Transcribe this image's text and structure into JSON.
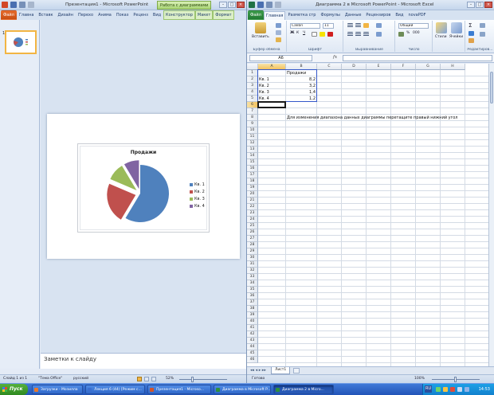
{
  "ppt": {
    "title": "Презентация1 - Microsoft PowerPoint",
    "context_tab_group": "Работа с диаграммами",
    "tabs": [
      "Файл",
      "Главна",
      "Вставк",
      "Дизайн",
      "Перехо",
      "Анима",
      "Показ",
      "Реценз",
      "Вид",
      "Конструктор",
      "Макет",
      "Формат"
    ],
    "slide_number": "1",
    "notes_placeholder": "Заметки к слайду",
    "status": {
      "slide": "Слайд 1 из 1",
      "theme": "\"Тема Office\"",
      "language": "русский",
      "zoom": "52%"
    }
  },
  "chart": {
    "title": "Продажи",
    "legend": [
      "Кв. 1",
      "Кв. 2",
      "Кв. 3",
      "Кв. 4"
    ],
    "colors": [
      "#4f81bd",
      "#c0504d",
      "#9bbb59",
      "#8064a2"
    ]
  },
  "chart_data": {
    "type": "pie",
    "title": "Продажи",
    "categories": [
      "Кв. 1",
      "Кв. 2",
      "Кв. 3",
      "Кв. 4"
    ],
    "values": [
      8.2,
      3.2,
      1.4,
      1.2
    ],
    "legend_position": "right"
  },
  "excel": {
    "title": "Диаграмма 2 в Microsoft PowerPoint - Microsoft Excel",
    "tabs": [
      "Файл",
      "Главная",
      "Разметка стр",
      "Формулы",
      "Данные",
      "Рецензиров",
      "Вид",
      "novaPDF"
    ],
    "ribbon": {
      "paste": "Вставить",
      "font_name": "Calibri",
      "font_size": "11",
      "number_format": "Общий",
      "styles": "Стили",
      "cells": "Ячейки",
      "groups": [
        "Буфер обмена",
        "Шрифт",
        "Выравнивание",
        "Число",
        "Редактиров..."
      ]
    },
    "name_box": "A6",
    "fx": "fx",
    "columns": [
      "A",
      "B",
      "C",
      "D",
      "E",
      "F",
      "G",
      "H"
    ],
    "rows": [
      "1",
      "2",
      "3",
      "4",
      "5",
      "6",
      "7",
      "8",
      "9",
      "10",
      "11",
      "12",
      "13",
      "14",
      "15",
      "16",
      "17",
      "18",
      "19",
      "20",
      "21",
      "22",
      "23",
      "24",
      "25",
      "26",
      "27",
      "28",
      "29",
      "30",
      "31",
      "32",
      "33",
      "34",
      "35",
      "36",
      "37",
      "38",
      "39",
      "40",
      "41",
      "42",
      "43",
      "44",
      "45",
      "46"
    ],
    "cells": {
      "B1": "Продажи",
      "A2": "Кв. 1",
      "B2": "8,2",
      "A3": "Кв. 2",
      "B3": "3,2",
      "A4": "Кв. 3",
      "B4": "1,4",
      "A5": "Кв. 4",
      "B5": "1,2",
      "B8": "Для изменения диапазона данных диаграммы перетащите правый нижний угол"
    },
    "sheet_tab": "Лист1",
    "status": {
      "ready": "Готово",
      "zoom": "100%"
    }
  },
  "taskbar": {
    "start": "Пуск",
    "tasks": [
      {
        "label": "Загрузки - Мозилла",
        "color": "#e8792c"
      },
      {
        "label": "Лекция 6 (44) [Режим с...",
        "color": "#3b6fcf"
      },
      {
        "label": "Презентация1 - Microso...",
        "color": "#d2542a"
      },
      {
        "label": "Диаграмма в Microsoft P...",
        "color": "#2f8f3d"
      },
      {
        "label": "Диаграмма 2 в Micro...",
        "color": "#2f8f3d"
      }
    ],
    "lang": "RU",
    "time": "14:53"
  }
}
